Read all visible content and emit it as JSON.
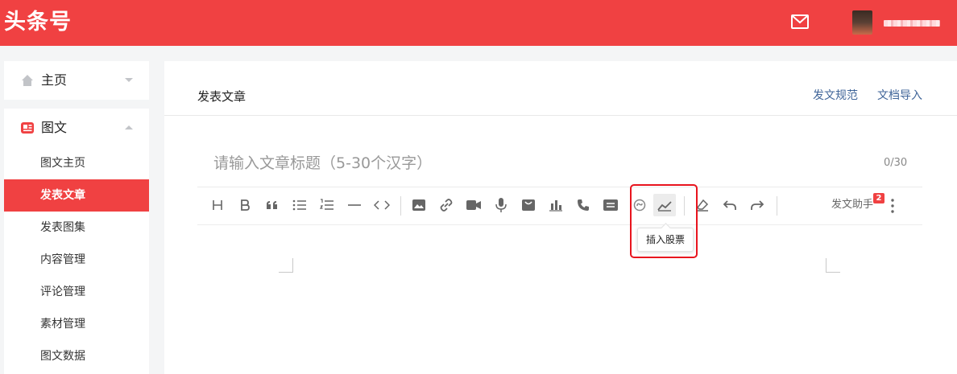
{
  "brand": {
    "logo_text": "头条号",
    "accent": "#f04142"
  },
  "header": {
    "mail_icon": "mail-icon"
  },
  "sidebar": {
    "home": {
      "label": "主页",
      "icon": "home-icon"
    },
    "tuwen": {
      "label": "图文",
      "icon": "article-icon",
      "items": [
        {
          "label": "图文主页"
        },
        {
          "label": "发表文章",
          "active": true
        },
        {
          "label": "发表图集"
        },
        {
          "label": "内容管理"
        },
        {
          "label": "评论管理"
        },
        {
          "label": "素材管理"
        },
        {
          "label": "图文数据"
        }
      ]
    }
  },
  "main": {
    "title": "发表文章",
    "links": {
      "guideline": "发文规范",
      "import": "文档导入"
    },
    "title_placeholder": "请输入文章标题（5-30个汉字）",
    "title_count": "0/30",
    "toolbar": {
      "assistant_label": "发文助手",
      "assistant_badge": "2",
      "tooltip": "插入股票"
    }
  }
}
